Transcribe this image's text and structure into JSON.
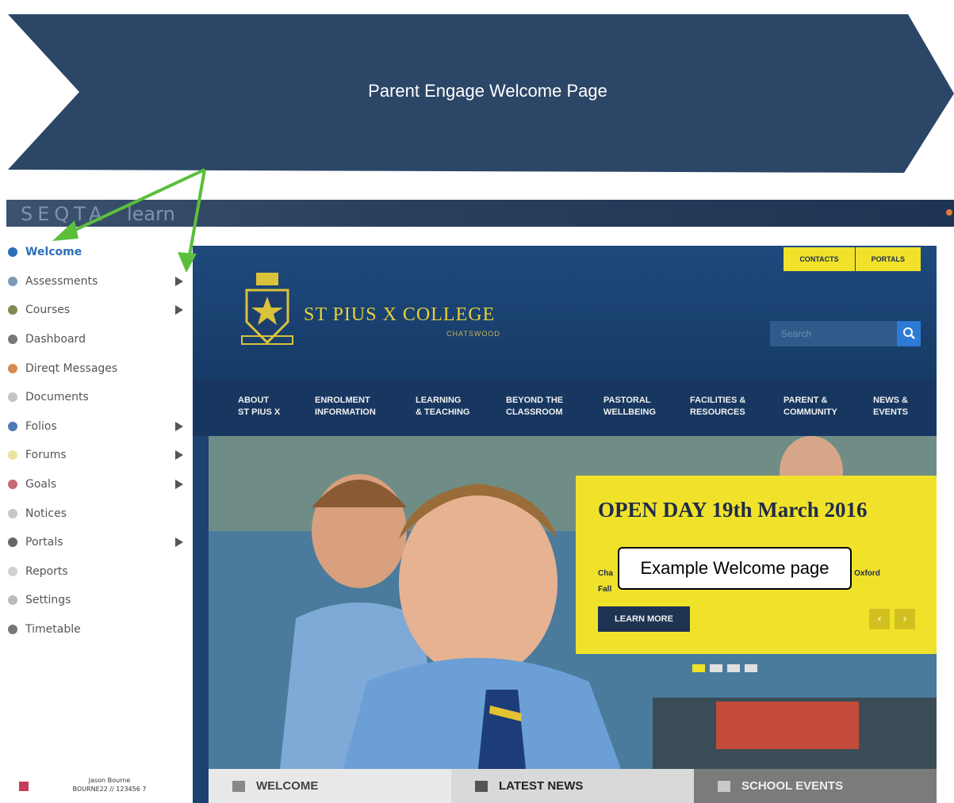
{
  "banner": {
    "title": "Parent Engage Welcome Page",
    "color": "#2c4667"
  },
  "annotation_color": "#5bbf3c",
  "seqta": {
    "logo": "SEQTA",
    "suffix": "learn"
  },
  "sidebar": {
    "items": [
      {
        "label": "Welcome",
        "icon": "info-icon",
        "color": "#2c6fb7",
        "active": true,
        "has_arrow": false
      },
      {
        "label": "Assessments",
        "icon": "check-icon",
        "color": "#7a9ab8",
        "has_arrow": true
      },
      {
        "label": "Courses",
        "icon": "book-icon",
        "color": "#7f8a52",
        "has_arrow": true
      },
      {
        "label": "Dashboard",
        "icon": "dashboard-icon",
        "color": "#777777",
        "has_arrow": false
      },
      {
        "label": "Direqt Messages",
        "icon": "messages-icon",
        "color": "#d48a52",
        "has_arrow": false
      },
      {
        "label": "Documents",
        "icon": "document-icon",
        "color": "#c4c4c4",
        "has_arrow": false
      },
      {
        "label": "Folios",
        "icon": "folio-icon",
        "color": "#4f79b4",
        "has_arrow": true
      },
      {
        "label": "Forums",
        "icon": "forum-icon",
        "color": "#e8e4a0",
        "has_arrow": true
      },
      {
        "label": "Goals",
        "icon": "goal-icon",
        "color": "#c46a72",
        "has_arrow": true
      },
      {
        "label": "Notices",
        "icon": "notice-icon",
        "color": "#c8c8c8",
        "has_arrow": false
      },
      {
        "label": "Portals",
        "icon": "globe-icon",
        "color": "#666666",
        "has_arrow": true
      },
      {
        "label": "Reports",
        "icon": "report-icon",
        "color": "#d0d0d0",
        "has_arrow": false
      },
      {
        "label": "Settings",
        "icon": "settings-icon",
        "color": "#bbbbbb",
        "has_arrow": false
      },
      {
        "label": "Timetable",
        "icon": "timetable-icon",
        "color": "#777777",
        "has_arrow": false
      }
    ]
  },
  "user": {
    "name": "Jason Bourne",
    "id": "BOURNE22 // 123456 7"
  },
  "site": {
    "top_links": [
      "CONTACTS",
      "PORTALS"
    ],
    "college_name": "ST PIUS X COLLEGE",
    "college_sub": "CHATSWOOD",
    "search_placeholder": "Search",
    "nav": [
      "ABOUT\nST PIUS X",
      "ENROLMENT\nINFORMATION",
      "LEARNING\n& TEACHING",
      "BEYOND THE\nCLASSROOM",
      "PASTORAL\nWELLBEING",
      "FACILITIES &\nRESOURCES",
      "PARENT &\nCOMMUNITY",
      "NEWS &\nEVENTS"
    ],
    "promo": {
      "title": "OPEN DAY 19th March 2016",
      "text_left_1": "Cha",
      "text_left_2": "Fall",
      "text_right": "t Oxford",
      "button": "LEARN MORE",
      "prev": "‹",
      "next": "›"
    },
    "tabs": [
      "WELCOME",
      "LATEST NEWS",
      "SCHOOL EVENTS"
    ],
    "accent": "#f0e22b",
    "navy": "#1d4170"
  },
  "callout": "Example Welcome page"
}
